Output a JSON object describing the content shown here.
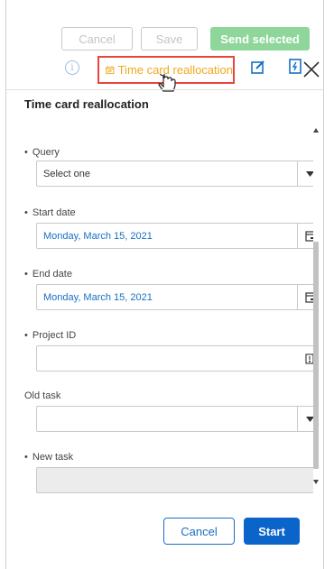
{
  "toolbar": {
    "cancel_label": "Cancel",
    "save_label": "Save",
    "send_label": "Send selected",
    "info_glyph": "i",
    "reallocate_label": "Time card reallocation",
    "icons": [
      "info-icon",
      "calendar-icon",
      "edit-icon",
      "document-icon",
      "pointer-hand-icon"
    ]
  },
  "dialog": {
    "title": "Time card reallocation",
    "close_glyph": "×",
    "fields": [
      {
        "label": "Query",
        "required": true,
        "value": "Select one",
        "type": "select"
      },
      {
        "label": "Start date",
        "required": true,
        "value": "Monday, March 15, 2021",
        "type": "date"
      },
      {
        "label": "End date",
        "required": true,
        "value": "Monday, March 15, 2021",
        "type": "date"
      },
      {
        "label": "Project ID",
        "required": true,
        "value": "",
        "type": "lookup"
      },
      {
        "label": "Old task",
        "required": false,
        "value": "",
        "type": "select"
      },
      {
        "label": "New task",
        "required": true,
        "value": "",
        "type": "disabled"
      }
    ],
    "required_marker": "•",
    "cancel_label": "Cancel",
    "start_label": "Start"
  },
  "colors": {
    "accent_blue": "#0b64c9",
    "send_green": "#8fd69b",
    "highlight_red": "#e8453c",
    "reallocate_orange": "#f0a81c",
    "value_blue": "#1a6fc2"
  }
}
